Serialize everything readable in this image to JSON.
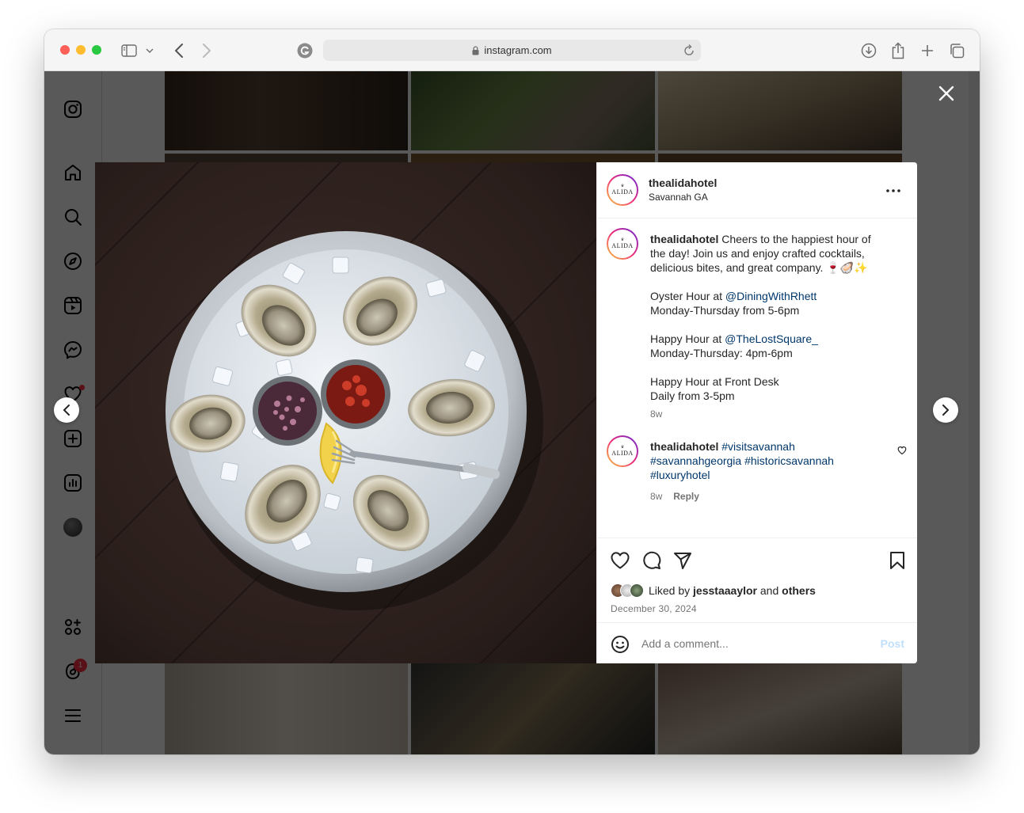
{
  "browser": {
    "url": "instagram.com",
    "traffic_lights": [
      "#fe5f57",
      "#febc2e",
      "#28c840"
    ]
  },
  "post": {
    "username": "thealidahotel",
    "location": "Savannah GA",
    "avatar_text": "ALIDA",
    "caption": {
      "username": "thealidahotel",
      "lead": "Cheers to the happiest hour of the day! Join us and enjoy crafted cocktails, delicious bites, and great company. 🍷🦪✨",
      "block1_title": "Oyster Hour at ",
      "block1_mention": "@DiningWithRhett",
      "block1_time": "Monday-Thursday from 5-6pm",
      "block2_title": "Happy Hour at ",
      "block2_mention": "@TheLostSquare_",
      "block2_time": "Monday-Thursday: 4pm-6pm",
      "block3_title": "Happy Hour at Front Desk",
      "block3_time": "Daily from 3-5pm",
      "age": "8w"
    },
    "comment": {
      "username": "thealidahotel",
      "hashtags": "#visitsavannah #savannahgeorgia #historicsavannah #luxuryhotel",
      "age": "8w",
      "reply_label": "Reply"
    },
    "likes": {
      "prefix": "Liked by ",
      "user": "jesstaaaylor",
      "middle": " and ",
      "others": "others"
    },
    "date": "December 30, 2024",
    "comment_placeholder": "Add a comment...",
    "post_label": "Post"
  },
  "notifications": {
    "threads_badge": "1"
  },
  "colors": {
    "accent_link": "#00376b",
    "post_button_disabled": "#c0dffd",
    "notification_red": "#ff3040"
  }
}
